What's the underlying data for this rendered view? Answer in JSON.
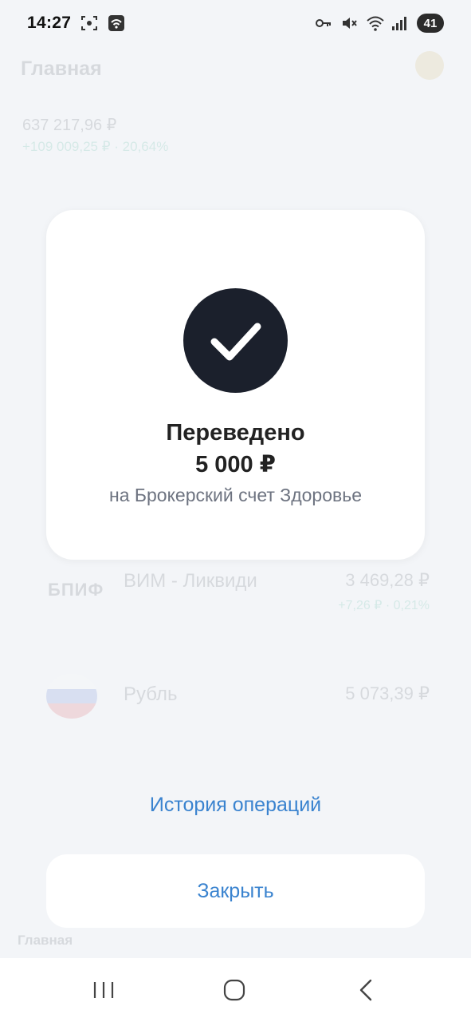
{
  "status_bar": {
    "time": "14:27",
    "battery_level": "41",
    "icons": [
      "screenshot-icon",
      "wifi-hotspot-icon",
      "key-icon",
      "mute-icon",
      "wifi-icon",
      "signal-icon"
    ]
  },
  "background": {
    "title": "Главная",
    "total_value": "637 217,96 ₽",
    "total_profit": "+109 009,25 ₽ · 20,64%",
    "rows": [
      {
        "logo": "БПИФ",
        "name": "ВИМ - Ликвиди",
        "value": "3 469,28 ₽",
        "sub": "+7,26 ₽ · 0,21%"
      },
      {
        "logo": "flag",
        "name": "Рубль",
        "value": "5 073,39 ₽"
      }
    ],
    "bottom_nav_label": "Главная"
  },
  "success": {
    "title": "Переведено",
    "amount": "5 000 ₽",
    "target": "на Брокерский счет Здоровье"
  },
  "actions": {
    "history_label": "История операций",
    "close_label": "Закрыть"
  },
  "colors": {
    "accent": "#3a83cf",
    "check_circle": "#1b202c",
    "page_bg": "#f3f5f8",
    "card_bg": "#ffffff"
  }
}
